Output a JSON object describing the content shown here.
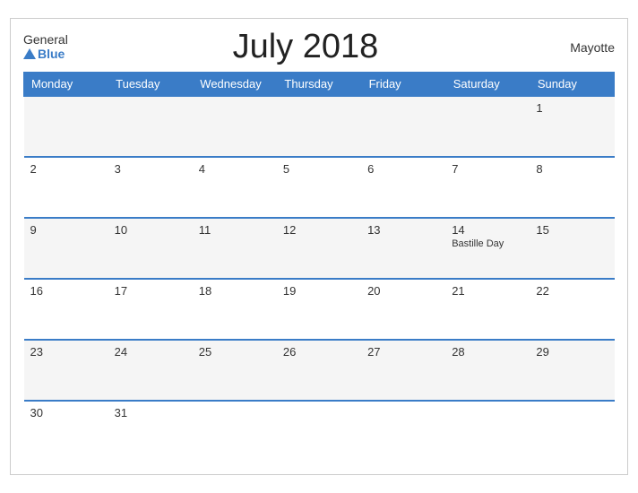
{
  "header": {
    "logo_line1": "General",
    "logo_line2": "Blue",
    "title": "July 2018",
    "region": "Mayotte"
  },
  "weekdays": [
    "Monday",
    "Tuesday",
    "Wednesday",
    "Thursday",
    "Friday",
    "Saturday",
    "Sunday"
  ],
  "weeks": [
    [
      {
        "day": "",
        "holiday": ""
      },
      {
        "day": "",
        "holiday": ""
      },
      {
        "day": "",
        "holiday": ""
      },
      {
        "day": "",
        "holiday": ""
      },
      {
        "day": "",
        "holiday": ""
      },
      {
        "day": "",
        "holiday": ""
      },
      {
        "day": "1",
        "holiday": ""
      }
    ],
    [
      {
        "day": "2",
        "holiday": ""
      },
      {
        "day": "3",
        "holiday": ""
      },
      {
        "day": "4",
        "holiday": ""
      },
      {
        "day": "5",
        "holiday": ""
      },
      {
        "day": "6",
        "holiday": ""
      },
      {
        "day": "7",
        "holiday": ""
      },
      {
        "day": "8",
        "holiday": ""
      }
    ],
    [
      {
        "day": "9",
        "holiday": ""
      },
      {
        "day": "10",
        "holiday": ""
      },
      {
        "day": "11",
        "holiday": ""
      },
      {
        "day": "12",
        "holiday": ""
      },
      {
        "day": "13",
        "holiday": ""
      },
      {
        "day": "14",
        "holiday": "Bastille Day"
      },
      {
        "day": "15",
        "holiday": ""
      }
    ],
    [
      {
        "day": "16",
        "holiday": ""
      },
      {
        "day": "17",
        "holiday": ""
      },
      {
        "day": "18",
        "holiday": ""
      },
      {
        "day": "19",
        "holiday": ""
      },
      {
        "day": "20",
        "holiday": ""
      },
      {
        "day": "21",
        "holiday": ""
      },
      {
        "day": "22",
        "holiday": ""
      }
    ],
    [
      {
        "day": "23",
        "holiday": ""
      },
      {
        "day": "24",
        "holiday": ""
      },
      {
        "day": "25",
        "holiday": ""
      },
      {
        "day": "26",
        "holiday": ""
      },
      {
        "day": "27",
        "holiday": ""
      },
      {
        "day": "28",
        "holiday": ""
      },
      {
        "day": "29",
        "holiday": ""
      }
    ],
    [
      {
        "day": "30",
        "holiday": ""
      },
      {
        "day": "31",
        "holiday": ""
      },
      {
        "day": "",
        "holiday": ""
      },
      {
        "day": "",
        "holiday": ""
      },
      {
        "day": "",
        "holiday": ""
      },
      {
        "day": "",
        "holiday": ""
      },
      {
        "day": "",
        "holiday": ""
      }
    ]
  ]
}
